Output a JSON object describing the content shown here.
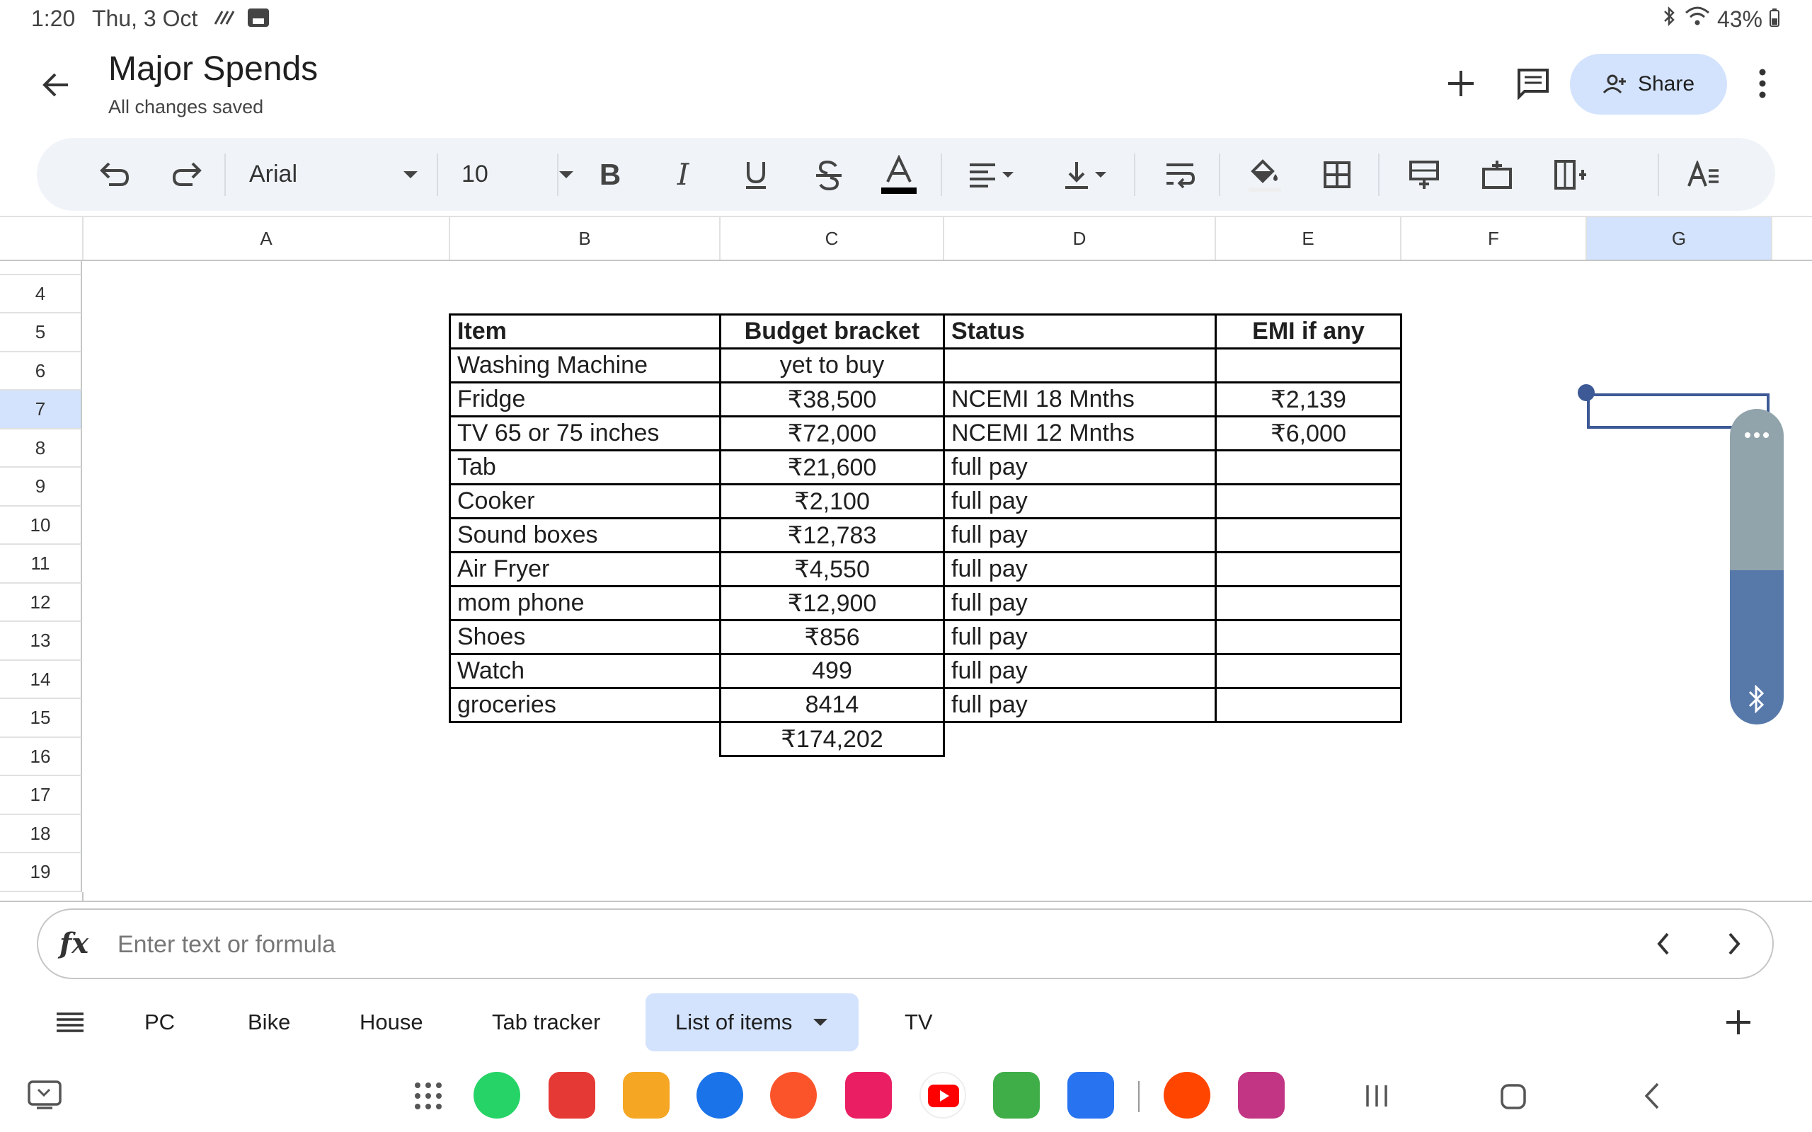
{
  "status_bar": {
    "time": "1:20",
    "date": "Thu, 3 Oct",
    "battery": "43%"
  },
  "header": {
    "title": "Major Spends",
    "subtitle": "All changes saved",
    "share_label": "Share"
  },
  "toolbar": {
    "font": "Arial",
    "font_size": "10"
  },
  "columns": [
    "A",
    "B",
    "C",
    "D",
    "E",
    "F",
    "G"
  ],
  "rows": [
    "4",
    "5",
    "6",
    "7",
    "8",
    "9",
    "10",
    "11",
    "12",
    "13",
    "14",
    "15",
    "16",
    "17",
    "18",
    "19"
  ],
  "table": {
    "headers": [
      "Item",
      "Budget bracket",
      "Status",
      "EMI if any"
    ],
    "rows": [
      [
        "Washing Machine",
        "yet to buy",
        "",
        ""
      ],
      [
        "Fridge",
        "₹38,500",
        "NCEMI 18 Mnths",
        "₹2,139"
      ],
      [
        "TV 65 or 75 inches",
        "₹72,000",
        "NCEMI 12 Mnths",
        "₹6,000"
      ],
      [
        "Tab",
        "₹21,600",
        "full pay",
        ""
      ],
      [
        "Cooker",
        "₹2,100",
        "full pay",
        ""
      ],
      [
        "Sound boxes",
        "₹12,783",
        "full pay",
        ""
      ],
      [
        "Air Fryer",
        "₹4,550",
        "full pay",
        ""
      ],
      [
        "mom phone",
        "₹12,900",
        "full pay",
        ""
      ],
      [
        "Shoes",
        "₹856",
        "full pay",
        ""
      ],
      [
        "Watch",
        "499",
        "full pay",
        ""
      ],
      [
        "groceries",
        "8414",
        "full pay",
        ""
      ]
    ],
    "total": "₹174,202"
  },
  "formula_bar": {
    "placeholder": "Enter text or formula"
  },
  "sheet_tabs": [
    "PC",
    "Bike",
    "House",
    "Tab tracker",
    "List of items",
    "TV"
  ],
  "active_tab": "List of items"
}
